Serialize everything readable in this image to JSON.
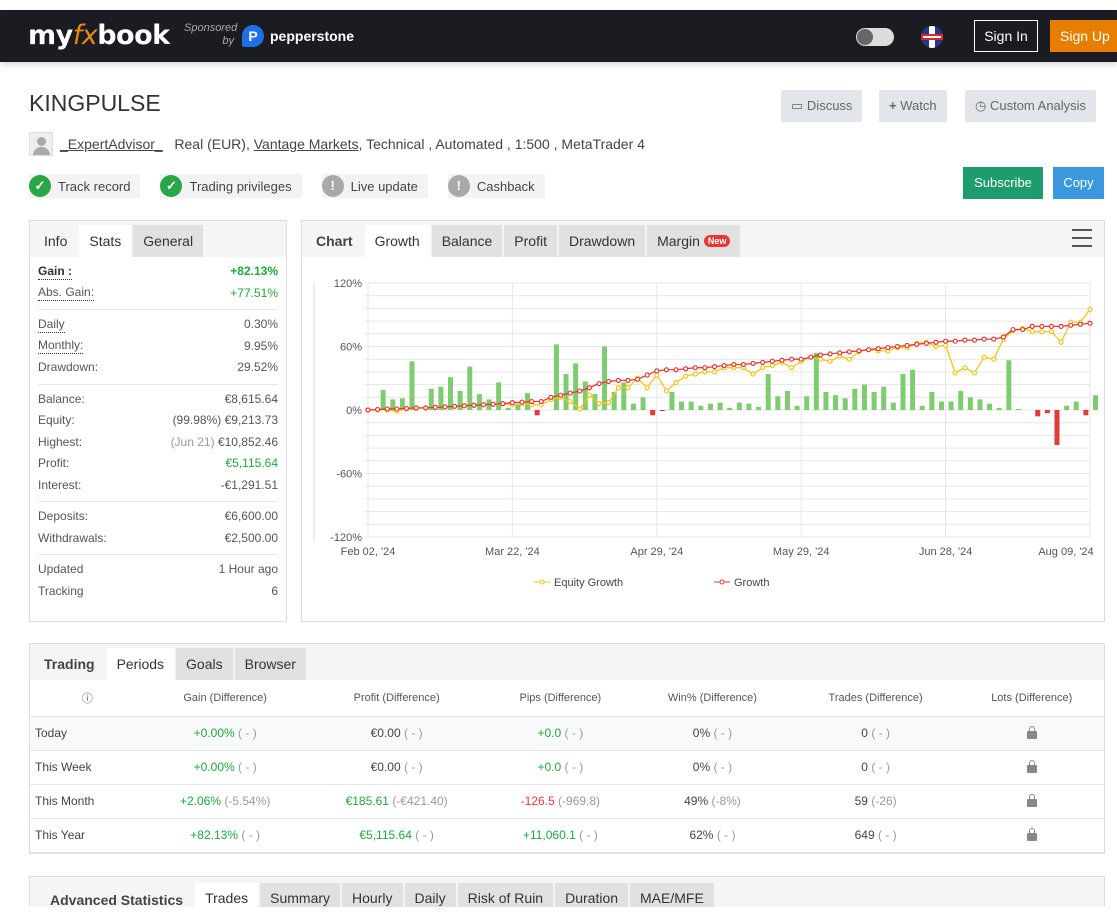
{
  "nav": {
    "logo": "myfxbook",
    "sponsored": "Sponsored by",
    "sponsor": "pepperstone",
    "sign_in": "Sign In",
    "sign_up": "Sign Up"
  },
  "header": {
    "title": "KINGPULSE",
    "discuss": "Discuss",
    "watch": "Watch",
    "custom_analysis": "Custom Analysis",
    "subscribe": "Subscribe",
    "copy": "Copy"
  },
  "meta": {
    "user": "_ExpertAdvisor_",
    "account": "Real (EUR),",
    "broker": "Vantage Markets",
    "rest": ", Technical , Automated , 1:500 , MetaTrader 4"
  },
  "badges": [
    {
      "label": "Track record",
      "status": "ok"
    },
    {
      "label": "Trading privileges",
      "status": "ok"
    },
    {
      "label": "Live update",
      "status": "warn"
    },
    {
      "label": "Cashback",
      "status": "warn"
    }
  ],
  "stats": {
    "tabs": [
      "Info",
      "Stats",
      "General"
    ],
    "groups": [
      [
        {
          "label": "Gain :",
          "value": "+82.13%",
          "color": "green",
          "dotted": true,
          "bold": true
        },
        {
          "label": "Abs. Gain:",
          "value": "+77.51%",
          "color": "green",
          "dotted": true
        }
      ],
      [
        {
          "label": "Daily",
          "value": "0.30%",
          "dotted": true
        },
        {
          "label": "Monthly:",
          "value": "9.95%",
          "dotted": true
        },
        {
          "label": "Drawdown:",
          "value": "29.52%"
        }
      ],
      [
        {
          "label": "Balance:",
          "value": "€8,615.64"
        },
        {
          "label": "Equity:",
          "note": "(99.98%)",
          "value": "€9,213.73"
        },
        {
          "label": "Highest:",
          "note": "(Jun 21)",
          "value": "€10,852.46"
        },
        {
          "label": "Profit:",
          "value": "€5,115.64",
          "color": "green"
        },
        {
          "label": "Interest:",
          "value": "-€1,291.51"
        }
      ],
      [
        {
          "label": "Deposits:",
          "value": "€6,600.00"
        },
        {
          "label": "Withdrawals:",
          "value": "€2,500.00"
        }
      ],
      [
        {
          "label": "Updated",
          "value": "1 Hour ago"
        },
        {
          "label": "Tracking",
          "value": "6"
        }
      ]
    ]
  },
  "chart_tabs": {
    "title": "Chart",
    "tabs": [
      "Growth",
      "Balance",
      "Profit",
      "Drawdown",
      "Margin"
    ],
    "new_badge": "New"
  },
  "chart_data": {
    "type": "line",
    "x_tick_labels": [
      "Feb 02, '24",
      "Mar 22, '24",
      "Apr 29, '24",
      "May 29, '24",
      "Jun 28, '24",
      "Aug 09, '24"
    ],
    "y_tick_labels": [
      "120%",
      "60%",
      "0%",
      "-60%",
      "-120%"
    ],
    "ylim": [
      -120,
      120
    ],
    "grid": true,
    "legend": "bottom",
    "colors": {
      "equity": "#f5c518",
      "growth": "#e53935",
      "bar_pos": "#7dcc6f",
      "bar_neg": "#e53935"
    },
    "series": [
      {
        "name": "Equity Growth",
        "values": [
          0,
          0,
          0,
          -1,
          1,
          1.5,
          2,
          2.5,
          3,
          3.5,
          4,
          4.5,
          5,
          5.5,
          6,
          5,
          6,
          5,
          5,
          10,
          12,
          8,
          1,
          14,
          6,
          7,
          21,
          21,
          30,
          21,
          33,
          18,
          26,
          32,
          34,
          36,
          36,
          40,
          40,
          40,
          34,
          40,
          42,
          45,
          40,
          46,
          50,
          48,
          46,
          51,
          48,
          55,
          57,
          56,
          56,
          59,
          59,
          63,
          64,
          60,
          61,
          35,
          40,
          35,
          50,
          48,
          67,
          75,
          77,
          74,
          74,
          74,
          64,
          83,
          83,
          95
        ]
      },
      {
        "name": "Growth",
        "values": [
          0,
          0.5,
          1,
          1,
          1.5,
          2,
          2,
          2.5,
          3,
          3.5,
          4,
          4.5,
          5,
          5.5,
          6,
          7,
          7.5,
          8,
          8,
          12,
          14,
          16,
          18,
          21,
          25,
          27,
          28,
          28,
          29,
          33,
          37,
          38,
          38,
          39,
          40,
          40,
          41,
          42,
          43,
          43,
          44,
          45,
          46,
          47,
          48,
          48,
          50,
          52,
          53,
          54,
          55,
          56,
          57,
          58,
          59,
          60,
          61,
          62,
          63,
          64,
          65,
          65,
          66,
          66,
          67,
          67,
          69,
          76,
          76,
          79,
          79,
          79,
          79,
          80,
          81,
          82
        ]
      },
      {
        "type": "bar",
        "values": [
          0,
          19,
          10,
          11,
          46,
          0,
          20,
          22,
          31,
          18,
          41,
          15,
          10,
          26,
          2,
          5,
          16,
          -5,
          0,
          62,
          34,
          44,
          27,
          15,
          60,
          17,
          26,
          6,
          12,
          -5,
          -1,
          17,
          8,
          8,
          4,
          6,
          7,
          2,
          7,
          6,
          3,
          34,
          13,
          18,
          4,
          13,
          54,
          17,
          14,
          11,
          20,
          24,
          17,
          22,
          7,
          34,
          38,
          4,
          17,
          8,
          8,
          18,
          12,
          10,
          6,
          2,
          47,
          1,
          0,
          -6,
          -3,
          -33,
          4,
          8,
          -5,
          14
        ]
      }
    ]
  },
  "periods": {
    "tabs": [
      "Trading",
      "Periods",
      "Goals",
      "Browser"
    ],
    "columns": [
      "Gain (Difference)",
      "Profit (Difference)",
      "Pips (Difference)",
      "Win% (Difference)",
      "Trades (Difference)",
      "Lots (Difference)"
    ],
    "rows": [
      {
        "period": "Today",
        "cells": [
          [
            "+0.00%",
            "( - )",
            "green"
          ],
          [
            "€0.00",
            "( - )",
            ""
          ],
          [
            "+0.0",
            "( - )",
            "green"
          ],
          [
            "0%",
            "( - )",
            ""
          ],
          [
            "0",
            "( - )",
            ""
          ]
        ]
      },
      {
        "period": "This Week",
        "cells": [
          [
            "+0.00%",
            "( - )",
            "green"
          ],
          [
            "€0.00",
            "( - )",
            ""
          ],
          [
            "+0.0",
            "( - )",
            "green"
          ],
          [
            "0%",
            "( - )",
            ""
          ],
          [
            "0",
            "( - )",
            ""
          ]
        ]
      },
      {
        "period": "This Month",
        "cells": [
          [
            "+2.06%",
            "(-5.54%)",
            "green"
          ],
          [
            "€185.61",
            "(-€421.40)",
            "green"
          ],
          [
            "-126.5",
            "(-969.8)",
            "red"
          ],
          [
            "49%",
            "(-8%)",
            ""
          ],
          [
            "59",
            "(-26)",
            ""
          ]
        ]
      },
      {
        "period": "This Year",
        "cells": [
          [
            "+82.13%",
            "( - )",
            "green"
          ],
          [
            "€5,115.64",
            "( - )",
            "green"
          ],
          [
            "+11,060.1",
            "( - )",
            "green"
          ],
          [
            "62%",
            "( - )",
            ""
          ],
          [
            "649",
            "( - )",
            ""
          ]
        ]
      }
    ]
  },
  "advanced": {
    "title": "Advanced Statistics",
    "tabs": [
      "Trades",
      "Summary",
      "Hourly",
      "Daily",
      "Risk of Ruin",
      "Duration",
      "MAE/MFE"
    ]
  }
}
